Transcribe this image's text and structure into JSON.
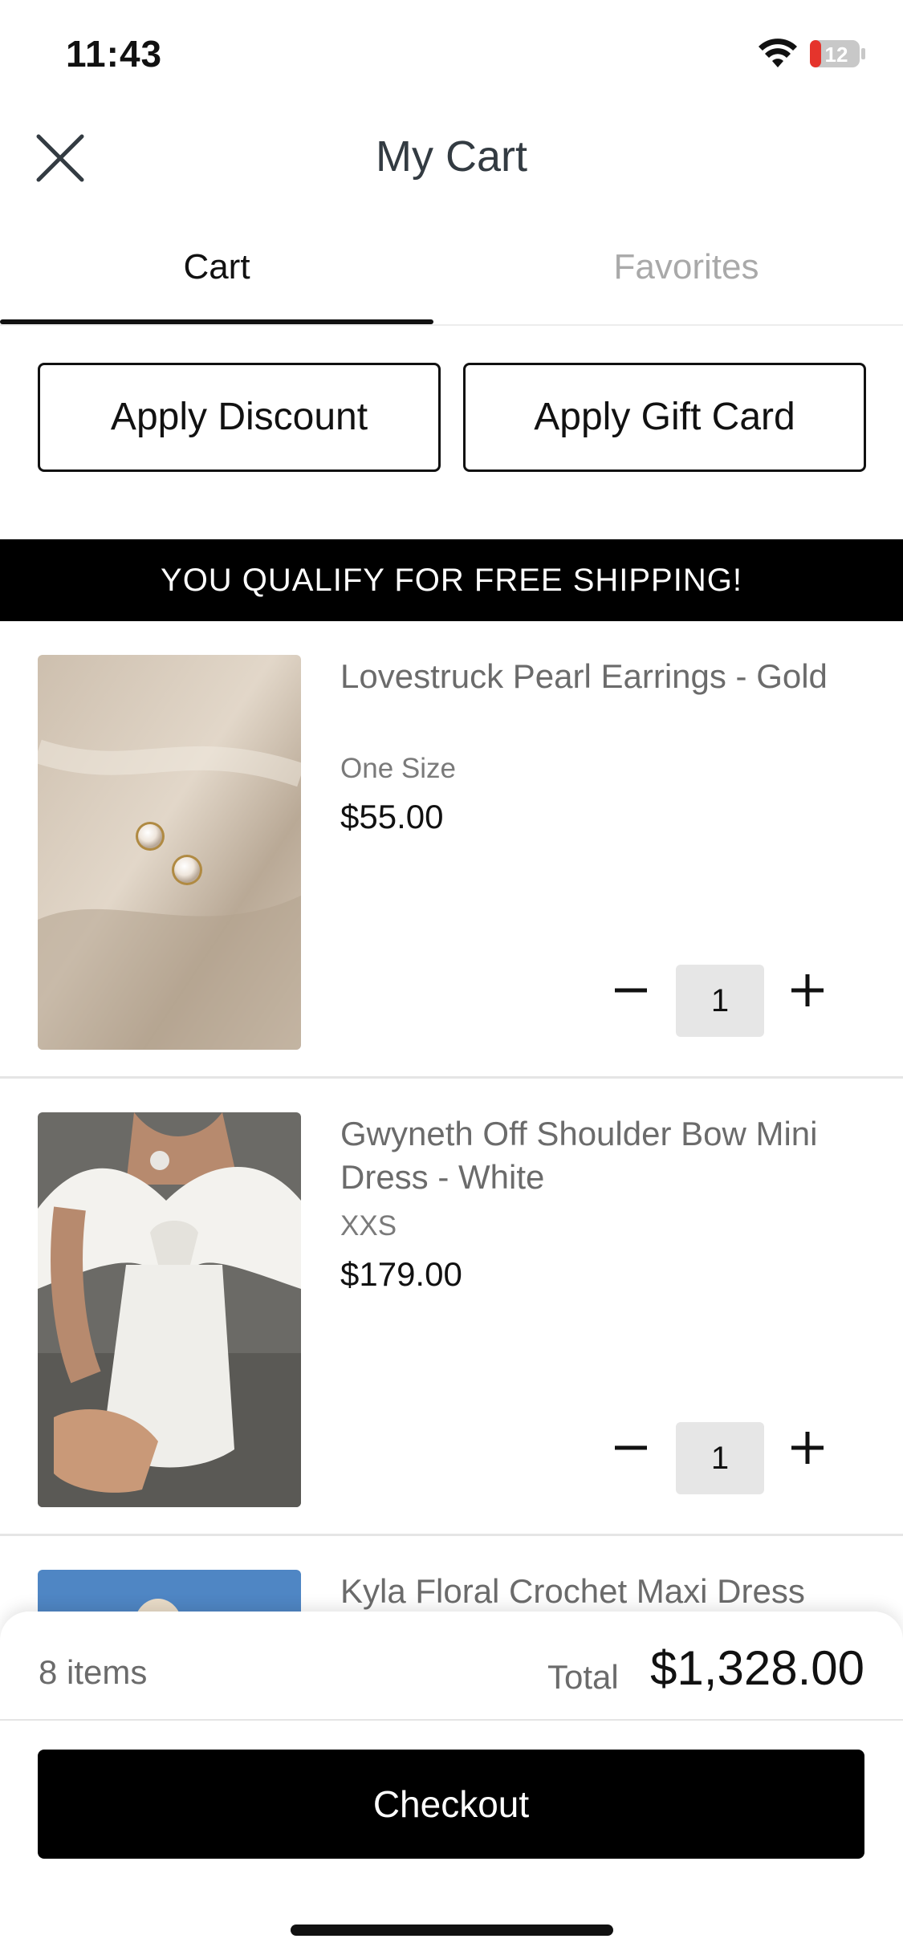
{
  "status_bar": {
    "time": "11:43",
    "battery": "12"
  },
  "header": {
    "title": "My Cart"
  },
  "tabs": [
    {
      "label": "Cart",
      "active": true
    },
    {
      "label": "Favorites",
      "active": false
    }
  ],
  "actions": {
    "discount_label": "Apply Discount",
    "gift_card_label": "Apply Gift Card"
  },
  "banner": {
    "text": "YOU QUALIFY FOR FREE SHIPPING!"
  },
  "cart_items": [
    {
      "name": "Lovestruck Pearl Earrings - Gold",
      "size": "One Size",
      "price": "$55.00",
      "quantity": "1"
    },
    {
      "name": "Gwyneth Off Shoulder Bow Mini Dress - White",
      "size": "XXS",
      "price": "$179.00",
      "quantity": "1"
    },
    {
      "name": "Kyla Floral Crochet Maxi Dress"
    }
  ],
  "summary": {
    "items_count": "8 items",
    "total_label": "Total",
    "total_value": "$1,328.00",
    "checkout_label": "Checkout"
  },
  "colors": {
    "accent": "#000000",
    "battery_low": "#e5342c",
    "inactive_tab": "#a9a9a9"
  }
}
